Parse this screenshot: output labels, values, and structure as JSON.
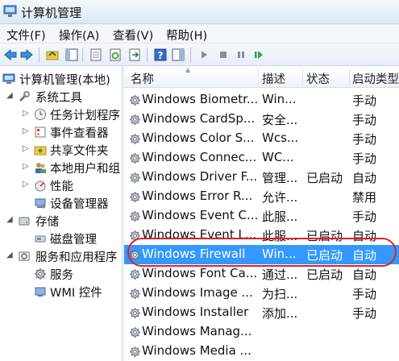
{
  "window": {
    "title": "计算机管理"
  },
  "menu": [
    {
      "label": "文件(F)"
    },
    {
      "label": "操作(A)"
    },
    {
      "label": "查看(V)"
    },
    {
      "label": "帮助(H)"
    }
  ],
  "toolbar_icons": [
    "back-icon",
    "forward-icon",
    "up-folder-icon",
    "show-hide-tree-icon",
    "properties-icon",
    "refresh-icon",
    "export-icon",
    "help-icon",
    "view-icon",
    "play-icon",
    "stop-icon",
    "pause-icon",
    "restart-icon"
  ],
  "tree": [
    {
      "label": "计算机管理(本地)",
      "icon": "computer-icon"
    },
    {
      "label": "系统工具",
      "icon": "tools-icon"
    },
    {
      "label": "任务计划程序",
      "icon": "clock-icon"
    },
    {
      "label": "事件查看器",
      "icon": "event-viewer-icon"
    },
    {
      "label": "共享文件夹",
      "icon": "shared-folder-icon"
    },
    {
      "label": "本地用户和组",
      "icon": "users-icon"
    },
    {
      "label": "性能",
      "icon": "performance-icon"
    },
    {
      "label": "设备管理器",
      "icon": "device-manager-icon"
    },
    {
      "label": "存储",
      "icon": "storage-icon"
    },
    {
      "label": "磁盘管理",
      "icon": "disk-icon"
    },
    {
      "label": "服务和应用程序",
      "icon": "services-apps-icon"
    },
    {
      "label": "服务",
      "icon": "services-icon"
    },
    {
      "label": "WMI 控件",
      "icon": "wmi-icon"
    }
  ],
  "columns": {
    "name": "名称",
    "description": "描述",
    "status": "状态",
    "startup": "启动类型"
  },
  "services": [
    {
      "name": "Windows Biometr...",
      "desc": "Win...",
      "status": "",
      "startup": "手动"
    },
    {
      "name": "Windows CardSp...",
      "desc": "安全...",
      "status": "",
      "startup": "手动"
    },
    {
      "name": "Windows Color S...",
      "desc": "Wcs...",
      "status": "",
      "startup": "手动"
    },
    {
      "name": "Windows Connec...",
      "desc": "WC...",
      "status": "",
      "startup": "手动"
    },
    {
      "name": "Windows Driver F...",
      "desc": "管理...",
      "status": "已启动",
      "startup": "自动"
    },
    {
      "name": "Windows Error R...",
      "desc": "允许...",
      "status": "",
      "startup": "禁用"
    },
    {
      "name": "Windows Event C...",
      "desc": "此服...",
      "status": "",
      "startup": "手动"
    },
    {
      "name": "Windows Event L...",
      "desc": "此服...",
      "status": "已启动",
      "startup": "自动"
    },
    {
      "name": "Windows Firewall",
      "desc": "Win...",
      "status": "已启动",
      "startup": "自动",
      "selected": true
    },
    {
      "name": "Windows Font Ca...",
      "desc": "通过...",
      "status": "已启动",
      "startup": "自动"
    },
    {
      "name": "Windows Image ...",
      "desc": "为扫...",
      "status": "",
      "startup": "手动"
    },
    {
      "name": "Windows Installer",
      "desc": "添加...",
      "status": "",
      "startup": "手动"
    },
    {
      "name": "Windows Manag...",
      "desc": "",
      "status": "",
      "startup": ""
    },
    {
      "name": "Windows Media ...",
      "desc": "",
      "status": "",
      "startup": ""
    }
  ],
  "colors": {
    "selection": "#3399ff",
    "annotation": "#e0202a"
  }
}
